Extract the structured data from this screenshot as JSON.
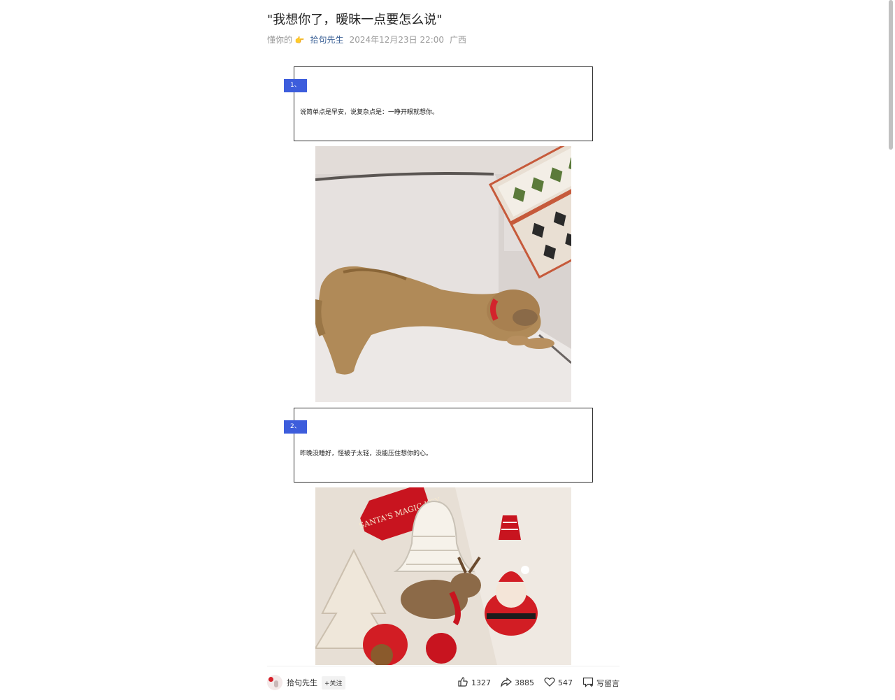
{
  "article": {
    "title": "\"我想你了，暧昧一点要怎么说\"",
    "meta": {
      "channel": "懂你的",
      "author": "拾句先生",
      "datetime": "2024年12月23日 22:00",
      "location": "广西"
    },
    "sections": [
      {
        "number": "1、",
        "text": "说简单点是早安，说复杂点是：一睁开眼就想你。"
      },
      {
        "number": "2、",
        "text": "昨晚没睡好，怪被子太轻，没能压住想你的心。"
      }
    ]
  },
  "photo2_card_text": "SANTA'S MAGIC KEY",
  "bottom_bar": {
    "author": "拾句先生",
    "follow_label": "+关注",
    "likes": "1327",
    "shares": "3885",
    "favorites": "547",
    "comment_label": "写留言"
  }
}
